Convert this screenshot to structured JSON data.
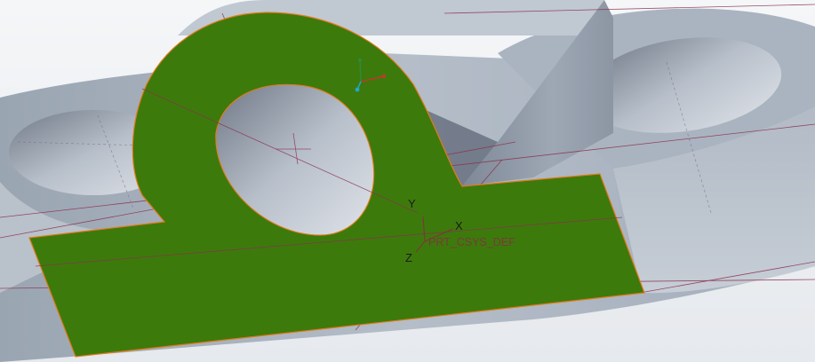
{
  "viewport": {
    "csys_label": "PRT_CSYS_DEF",
    "axis_x": "X",
    "axis_y": "Y",
    "axis_z": "Z"
  },
  "colors": {
    "background": "#eef0f3",
    "selected_surface": "#3d7a0c",
    "highlight_edge": "#e07a1a",
    "datum_plane": "#8a3050",
    "model_metal": "#a9b3bf"
  },
  "icons": {
    "small_triad": "view-orientation-triad-icon"
  }
}
